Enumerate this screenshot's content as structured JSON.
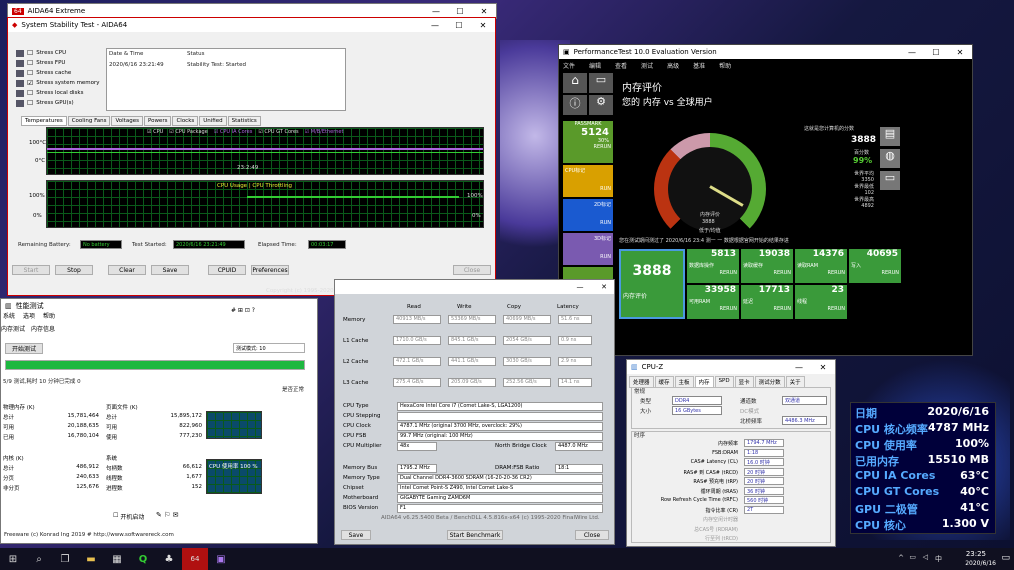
{
  "aida": {
    "title": "AIDA64 Extreme",
    "stab_title": "System Stability Test - AIDA64",
    "stress": [
      "Stress CPU",
      "Stress FPU",
      "Stress cache",
      "Stress system memory",
      "Stress local disks",
      "Stress GPU(s)"
    ],
    "log_headers": [
      "Date & Time",
      "Status"
    ],
    "log_row": [
      "2020/6/16 23:21:49",
      "Stability Test: Started"
    ],
    "tabs": [
      "Temperatures",
      "Cooling Fans",
      "Voltages",
      "Powers",
      "Clocks",
      "Unified",
      "Statistics"
    ],
    "legend": [
      "CPU",
      "CPU Package",
      "CPU IA Cores",
      "CPU GT Cores",
      "M/B/Ethernet"
    ],
    "g1_top": "100°C",
    "g1_bot": "0°C",
    "g1_time": "23:2:49",
    "g2_title": "CPU Usage | CPU Throttling",
    "g2_top": "100%",
    "g2_bot": "0%",
    "g2_r_top": "100%",
    "g2_r_bot": "0%",
    "battery_label": "Remaining Battery:",
    "battery_val": "No battery",
    "started_label": "Test Started:",
    "started_val": "2020/6/16 23:21:49",
    "elapsed_label": "Elapsed Time:",
    "elapsed_val": "00:03:17",
    "buttons": [
      "Start",
      "Stop",
      "Clear",
      "Save",
      "CPUID",
      "Preferences",
      "Close"
    ],
    "copyright": "Copyright (c) 1995-2020 FinalWire Ltd."
  },
  "pt": {
    "title": "PerformanceTest 10.0 Evaluation Version",
    "menu": [
      "文件",
      "编辑",
      "查看",
      "测试",
      "高级",
      "基准",
      "帮助"
    ],
    "heading": "内存评价",
    "subheading": "您的 内存 vs 全球用户",
    "passmark": "PASSMARK",
    "pm_score": "5124",
    "pm_sub": "30%",
    "rerun": "RERUN",
    "run": "RUN",
    "side": [
      "CPU标记",
      "2D标记",
      "3D标记"
    ],
    "right_label": "这就是您计算机的分数",
    "right_score": "3888",
    "right_pct_label": "百分数",
    "right_pct": "99%",
    "right_stats": [
      "世界平均",
      "3350",
      "世界最低",
      "102",
      "世界最高",
      "4892"
    ],
    "gauge_low": "内存评价",
    "gauge_score": "3888",
    "gauge_note": "低于/均值",
    "warn": "您在测试期间测过了 2020/6/16 23:4 测一 一 数据根据官网开始的结果存进",
    "main_tile": "3888",
    "main_tile_label": "内存评价",
    "tiles": [
      {
        "v": "5813",
        "l": "数据库操作"
      },
      {
        "v": "19038",
        "l": "读取缓存"
      },
      {
        "v": "14376",
        "l": "读取RAM"
      },
      {
        "v": "40695",
        "l": "写入"
      },
      {
        "v": "33958",
        "l": "可用RAM"
      },
      {
        "v": "17713",
        "l": "延迟"
      },
      {
        "v": "23",
        "l": "线程"
      }
    ]
  },
  "mem": {
    "title": "性能测试",
    "menu": [
      "系统",
      "选项",
      "帮助"
    ],
    "tabs": [
      "内存测试",
      "内存信息"
    ],
    "run_btn": "开始测试",
    "dropdown": "测试模式: 10",
    "progress_label": "5/9 测试,耗时 10 分钟已完成 0",
    "status_right": "是否正常",
    "phys": "物理内存 (K)",
    "phys_rows": [
      [
        "总计",
        "15,781,464"
      ],
      [
        "可用",
        "20,188,635"
      ],
      [
        "已用",
        "16,780,104"
      ]
    ],
    "paging": "页面文件 (K)",
    "paging_rows": [
      [
        "总计",
        "15,895,172"
      ],
      [
        "可用",
        "822,960"
      ],
      [
        "使用",
        "777,230"
      ]
    ],
    "kernel": "内核 (K)",
    "kernel_rows": [
      [
        "总计",
        "486,912"
      ],
      [
        "分页",
        "240,633"
      ],
      [
        "非分页",
        "125,676"
      ]
    ],
    "sys": "系统",
    "sys_rows": [
      [
        "句柄数",
        "66,612"
      ],
      [
        "线程数",
        "1,677"
      ],
      [
        "进程数",
        "152"
      ]
    ],
    "cpu_graph": "CPU 使用率 100 %",
    "stop_label": "开机启动",
    "footer": "Freeware (c) Konrad Ing 2019 # http://www.softwarereck.com"
  },
  "bench": {
    "cols": [
      "Read",
      "Write",
      "Copy",
      "Latency"
    ],
    "rows": [
      [
        "Memory",
        "40913 MB/s",
        "53369 MB/s",
        "40699 MB/s",
        "51.6 ns"
      ],
      [
        "L1 Cache",
        "1710.0 GB/s",
        "845.1 GB/s",
        "2054 GB/s",
        "0.9 ns"
      ],
      [
        "L2 Cache",
        "472.1 GB/s",
        "441.1 GB/s",
        "3030 GB/s",
        "2.9 ns"
      ],
      [
        "L3 Cache",
        "275.4 GB/s",
        "205.09 GB/s",
        "252.56 GB/s",
        "14.1 ns"
      ]
    ],
    "info": [
      [
        "CPU Type",
        "HexaCore Intel Core i7 (Comet Lake-S, LGA1200)"
      ],
      [
        "CPU Stepping",
        ""
      ],
      [
        "CPU Clock",
        "4787.1 MHz (original 3700 MHz, overclock: 29%)"
      ],
      [
        "CPU FSB",
        "99.7 MHz (original: 100 MHz)"
      ],
      [
        "CPU Multiplier",
        "48x"
      ]
    ],
    "nb_label": "North Bridge Clock",
    "nb_val": "4487.0 MHz",
    "info2": [
      [
        "Memory Bus",
        "1795.2 MHz"
      ],
      [
        "Memory Type",
        "Dual Channel DDR4-3600 SDRAM (16-20-20-36 CR2)"
      ],
      [
        "Chipset",
        "Intel Comet Point-S Z490, Intel Comet Lake-S"
      ],
      [
        "Motherboard",
        "GIGABYTE Gaming ZAMD6M"
      ],
      [
        "BIOS Version",
        "F1"
      ]
    ],
    "dram_label": "DRAM:FSB Ratio",
    "dram_val": "18:1",
    "footer": "AIDA64 v6.25.5400 Beta / BenchDLL 4.5.816x-x64 (c) 1995-2020 FinalWire Ltd.",
    "save": "Save",
    "start": "Start Benchmark",
    "close": "Close"
  },
  "cpuz": {
    "title": "CPU-Z",
    "tabs": [
      "处理器",
      "缓存",
      "主板",
      "内存",
      "SPD",
      "显卡",
      "测试分数",
      "关于"
    ],
    "general": "常规",
    "type_label": "类型",
    "type": "DDR4",
    "size_label": "大小",
    "size": "16 GBytes",
    "ch_label": "通道数",
    "ch": "双通道",
    "dc": "DC模式",
    "nb_label": "北桥频率",
    "nb": "4486.3 MHz",
    "timing": "时序",
    "timings": [
      [
        "内存频率",
        "1794.7 MHz"
      ],
      [
        "FSB:DRAM",
        "1:18"
      ],
      [
        "CAS# Latency (CL)",
        "16.0 时钟"
      ],
      [
        "RAS# 到 CAS# (tRCD)",
        "20 时钟"
      ],
      [
        "RAS# 预充电 (tRP)",
        "20 时钟"
      ],
      [
        "循环周期 (tRAS)",
        "36 时钟"
      ],
      [
        "Row Refresh Cycle Time (tRFC)",
        "560 时钟"
      ],
      [
        "指令比率 (CR)",
        "2T"
      ],
      [
        "内存空闲计时器",
        ""
      ],
      [
        "总CAS号 (RDRAM)",
        ""
      ],
      [
        "行至列 (tRCD)",
        ""
      ]
    ]
  },
  "hw": {
    "rows": [
      [
        "日期",
        "2020/6/16"
      ],
      [
        "CPU 核心频率",
        "4787 MHz"
      ],
      [
        "CPU 使用率",
        "100%"
      ],
      [
        "已用内存",
        "15510 MB"
      ],
      [
        "CPU IA Cores",
        "63°C"
      ],
      [
        "CPU GT Cores",
        "40°C"
      ],
      [
        "GPU 二极管",
        "41°C"
      ],
      [
        "CPU 核心",
        "1.300 V"
      ]
    ]
  },
  "taskbar": {
    "time": "23:25",
    "date": "2020/6/16",
    "lang": "中"
  }
}
